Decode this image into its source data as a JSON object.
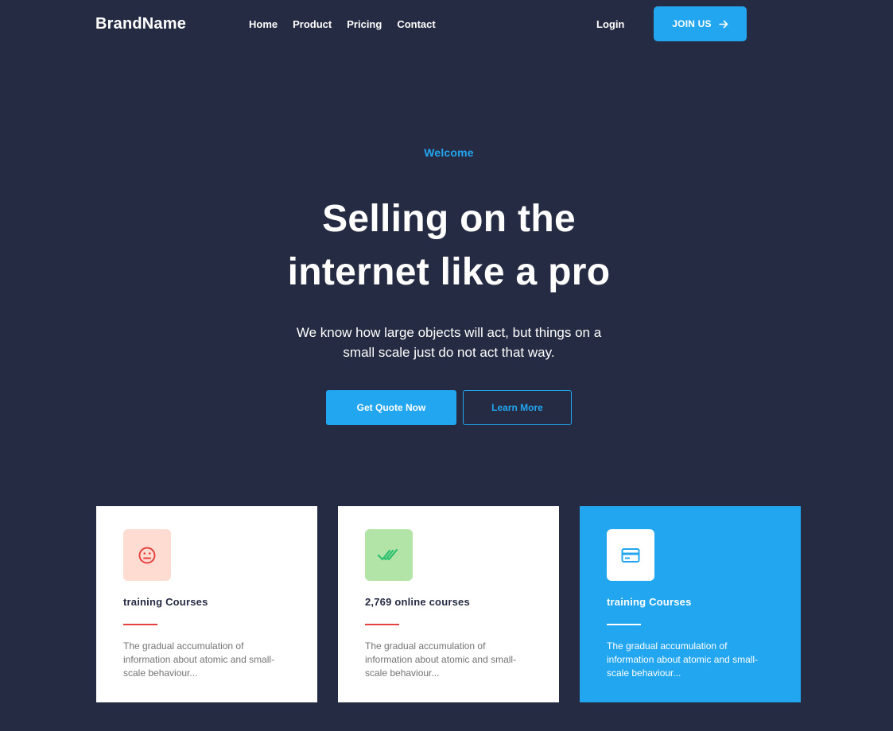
{
  "nav": {
    "brand": "BrandName",
    "links": [
      "Home",
      "Product",
      "Pricing",
      "Contact"
    ],
    "login": "Login",
    "join_label": "JOIN US",
    "join_icon": "arrow-right-icon"
  },
  "hero": {
    "eyebrow": "Welcome",
    "title_lines": [
      "Selling on the",
      "internet like a pro"
    ],
    "subtitle_lines": [
      "We know how large objects will act, but things on a",
      "small scale just do not act that way."
    ],
    "primary_button": "Get Quote Now",
    "secondary_button": "Learn More"
  },
  "cards": [
    {
      "icon": "sad-face-icon",
      "icon_bg": "#FFDCD1",
      "icon_color": "#E74040",
      "title": "training Courses",
      "text": "The gradual accumulation of information about atomic and small-scale behaviour..."
    },
    {
      "icon": "double-check-icon",
      "icon_bg": "#B2E3A7",
      "icon_color": "#2DC071",
      "title": "2,769 online courses",
      "text": "The gradual accumulation of information about atomic and small-scale behaviour..."
    },
    {
      "icon": "credit-card-icon",
      "icon_bg": "#FFFFFF",
      "icon_color": "#23A6F0",
      "title": "training Courses",
      "text": "The gradual accumulation of information about atomic and small-scale behaviour..."
    }
  ],
  "colors": {
    "background": "#252B42",
    "primary": "#23A6F0",
    "accent_line": "#E74040",
    "muted_text": "#737373"
  }
}
